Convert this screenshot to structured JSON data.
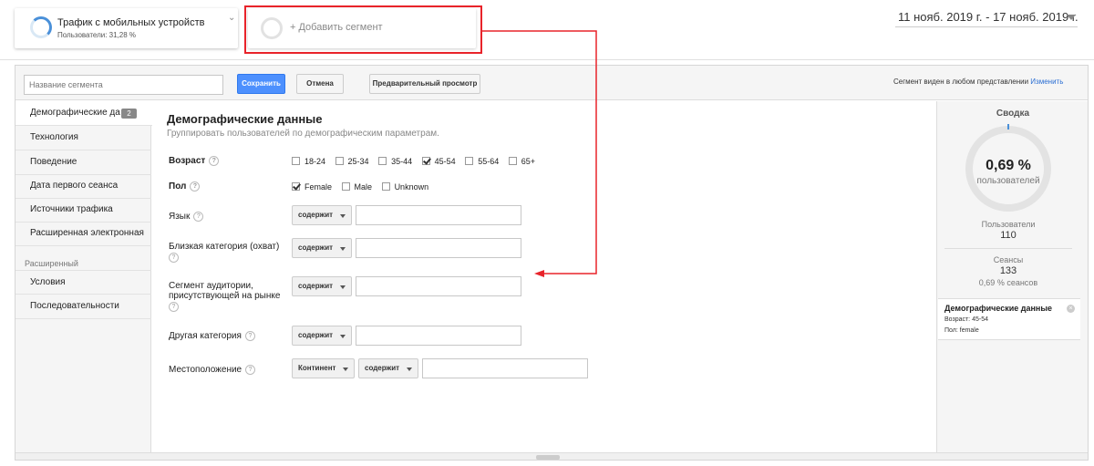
{
  "top_segments": {
    "active_segment": {
      "title": "Трафик с мобильных устройств",
      "subtitle": "Пользователи: 31,28 %"
    },
    "add_segment_label": "+ Добавить сегмент"
  },
  "date_range": "11 нояб. 2019 г. - 17 нояб. 2019 г.",
  "builder": {
    "name_placeholder": "Название сегмента",
    "save_label": "Сохранить",
    "cancel_label": "Отмена",
    "preview_label": "Предварительный просмотр",
    "visibility_text": "Сегмент виден в любом представлении",
    "visibility_link": "Изменить"
  },
  "sidebar": {
    "items": [
      {
        "label": "Демографические да",
        "badge": "2"
      },
      {
        "label": "Технология"
      },
      {
        "label": "Поведение"
      },
      {
        "label": "Дата первого сеанса"
      },
      {
        "label": "Источники трафика"
      },
      {
        "label": "Расширенная электронная"
      }
    ],
    "advanced_section": "Расширенный",
    "advanced_items": [
      {
        "label": "Условия"
      },
      {
        "label": "Последовательности"
      }
    ]
  },
  "content": {
    "title": "Демографические данные",
    "description": "Группировать пользователей по демографическим параметрам.",
    "age_label": "Возраст",
    "age_options": [
      {
        "label": "18-24",
        "checked": false
      },
      {
        "label": "25-34",
        "checked": false
      },
      {
        "label": "35-44",
        "checked": false
      },
      {
        "label": "45-54",
        "checked": true
      },
      {
        "label": "55-64",
        "checked": false
      },
      {
        "label": "65+",
        "checked": false
      }
    ],
    "gender_label": "Пол",
    "gender_options": [
      {
        "label": "Female",
        "checked": true
      },
      {
        "label": "Male",
        "checked": false
      },
      {
        "label": "Unknown",
        "checked": false
      }
    ],
    "language_label": "Язык",
    "affinity_label": "Близкая категория (охват)",
    "in_market_label_1": "Сегмент аудитории,",
    "in_market_label_2": "присутствующей на рынке",
    "other_category_label": "Другая категория",
    "location_label": "Местоположение",
    "contains_label": "содержит",
    "continent_label": "Континент",
    "help_symbol": "?"
  },
  "summary": {
    "title": "Сводка",
    "percent": "0,69 %",
    "percent_sub": "пользователей",
    "users_label": "Пользователи",
    "users_value": "110",
    "sessions_label": "Сеансы",
    "sessions_value": "133",
    "sessions_pct": "0,69 % сеансов",
    "condition_title": "Демографические данные",
    "condition_age": "Возраст: 45-54",
    "condition_gender": "Пол: female"
  },
  "colors": {
    "accent_blue": "#4d90fe",
    "annotation_red": "#e8232a",
    "link_blue": "#2a6ed3"
  }
}
